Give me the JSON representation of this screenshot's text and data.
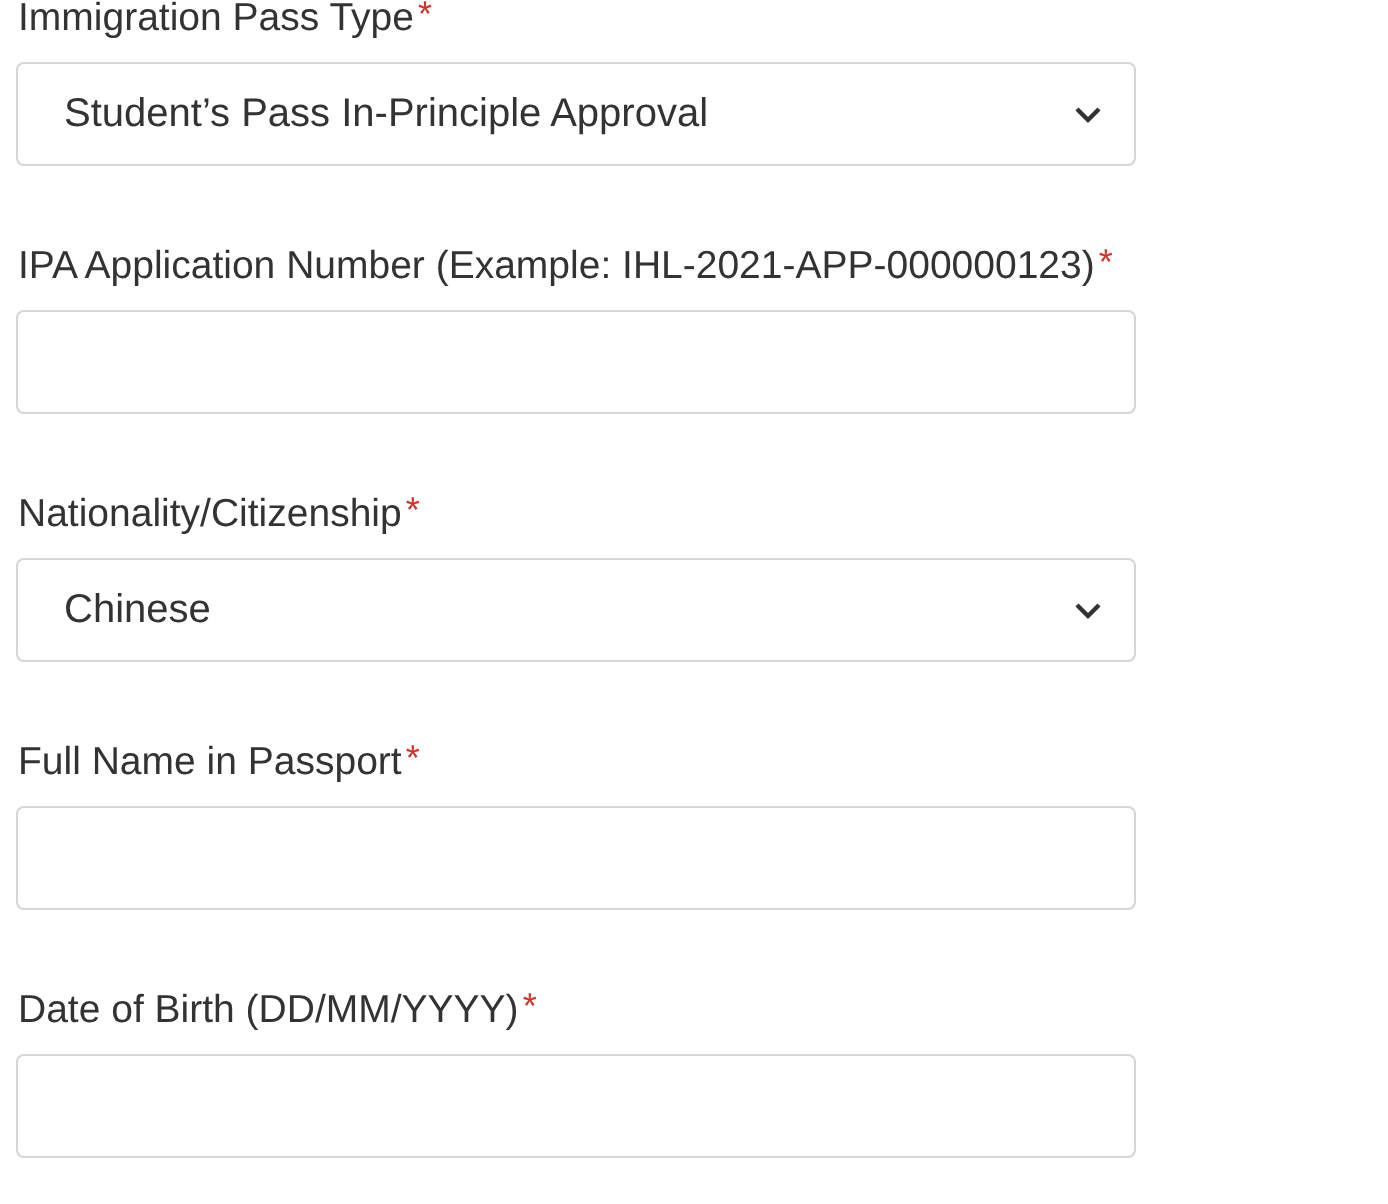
{
  "fields": [
    {
      "kind": "select",
      "label": "Immigration Pass Type",
      "asterisk": "*",
      "value": "Student’s Pass In-Principle Approval"
    },
    {
      "kind": "text",
      "label": "IPA Application Number (Example: IHL-2021-APP-000000123)",
      "asterisk": "*"
    },
    {
      "kind": "select",
      "label": "Nationality/Citizenship",
      "asterisk": "*",
      "value": "Chinese"
    },
    {
      "kind": "text",
      "label": "Full Name in Passport",
      "asterisk": "*"
    },
    {
      "kind": "text",
      "label": "Date of Birth (DD/MM/YYYY)",
      "asterisk": "*"
    }
  ]
}
